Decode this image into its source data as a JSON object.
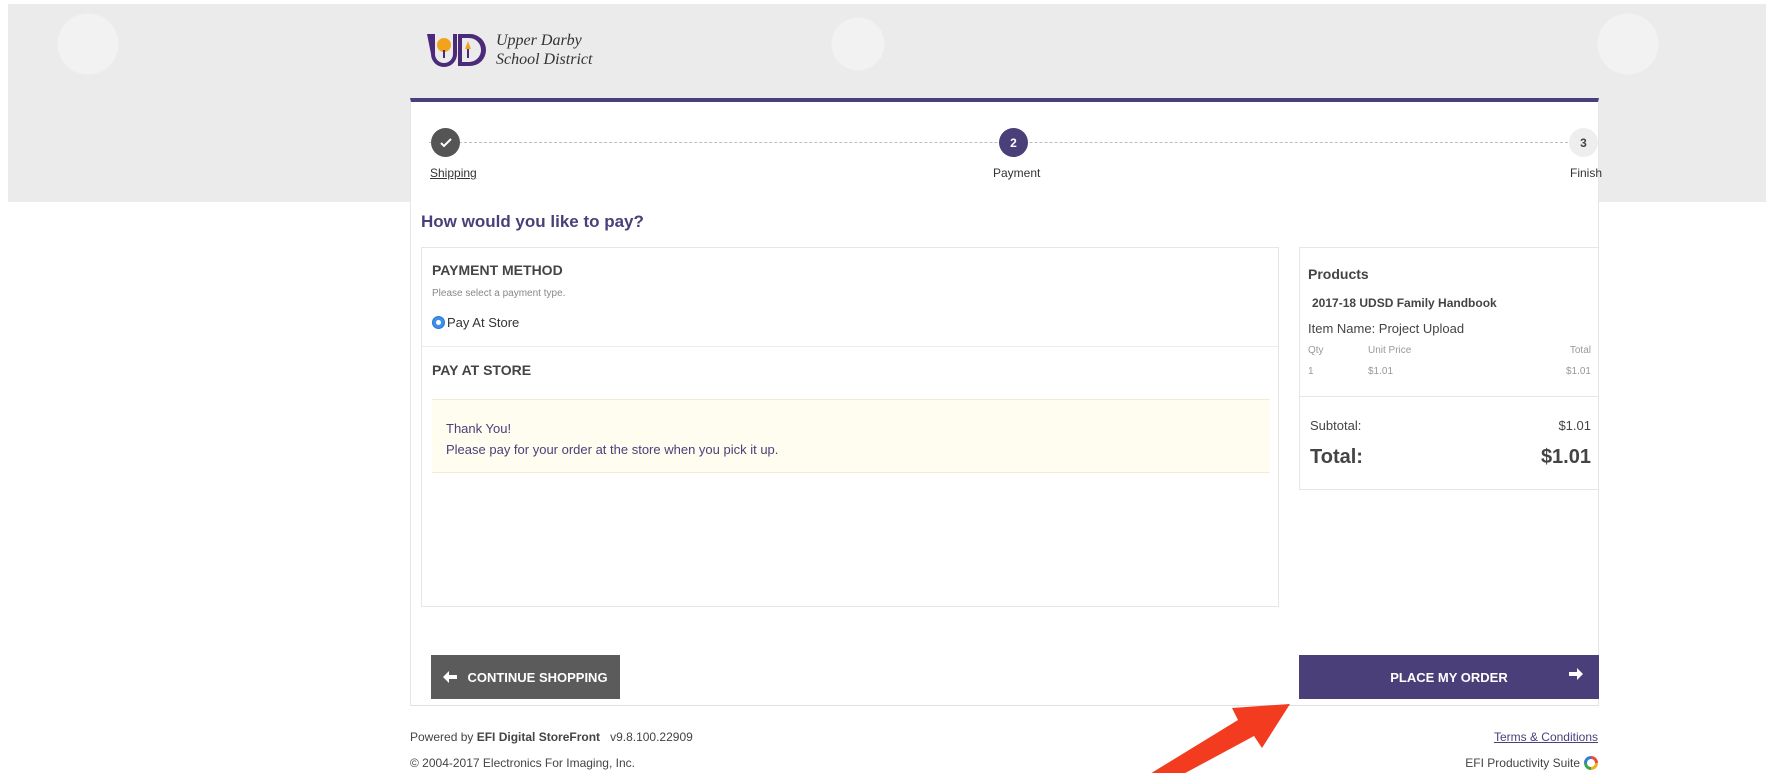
{
  "brand": {
    "line1": "Upper Darby",
    "line2": "School District",
    "logo_letters": "UD",
    "accent_color": "#4b3f7a"
  },
  "steps": [
    {
      "number": "",
      "label": "Shipping",
      "state": "done"
    },
    {
      "number": "2",
      "label": "Payment",
      "state": "active"
    },
    {
      "number": "3",
      "label": "Finish",
      "state": "pending"
    }
  ],
  "heading": "How would you like to pay?",
  "payment": {
    "method_title": "PAYMENT METHOD",
    "hint": "Please select a payment type.",
    "option_label": "Pay At Store",
    "section_title": "PAY AT STORE",
    "notice_line1": "Thank You!",
    "notice_line2": "Please pay for your order at the store when you pick it up."
  },
  "summary": {
    "title": "Products",
    "item": "2017-18 UDSD Family Handbook",
    "item_name": "Item Name: Project Upload",
    "columns": {
      "qty": "Qty",
      "unit_price": "Unit Price",
      "total": "Total"
    },
    "row": {
      "qty": "1",
      "unit_price": "$1.01",
      "total": "$1.01"
    },
    "subtotal_label": "Subtotal:",
    "subtotal_value": "$1.01",
    "total_label": "Total:",
    "total_value": "$1.01"
  },
  "buttons": {
    "continue_label": "CONTINUE SHOPPING",
    "place_label": "PLACE MY ORDER"
  },
  "footer": {
    "powered_prefix": "Powered by ",
    "powered_brand": "EFI Digital StoreFront",
    "version": "v9.8.100.22909",
    "copyright": "© 2004-2017 Electronics For Imaging, Inc.",
    "terms": "Terms & Conditions",
    "suite": "EFI Productivity Suite"
  }
}
